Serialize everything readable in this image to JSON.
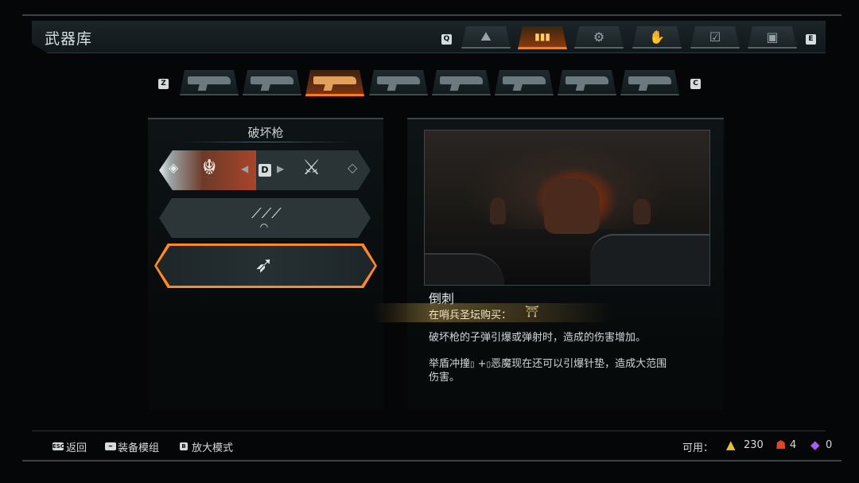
{
  "header": {
    "title": "武器库",
    "prev_key": "Q",
    "next_key": "E",
    "tabs": [
      {
        "icon": "map-icon",
        "glyph": "⛰"
      },
      {
        "icon": "ammo-icon",
        "glyph": "▮▮▮"
      },
      {
        "icon": "gear-icon",
        "glyph": "⚙"
      },
      {
        "icon": "codex-icon",
        "glyph": "✋"
      },
      {
        "icon": "checklist-icon",
        "glyph": "☑"
      },
      {
        "icon": "dossier-icon",
        "glyph": "▣"
      }
    ],
    "active_tab": 1
  },
  "weapons": {
    "prev_key": "Z",
    "next_key": "C",
    "active_index": 2
  },
  "left_panel": {
    "title": "破坏枪",
    "mod1": {
      "left_glyph": "◈",
      "switch_key": "D",
      "right_glyph": "◇",
      "left_icon": "demon-figure-icon",
      "right_icon": "impaled-figure-icon"
    },
    "mod2_glyph": "⟋⟋⟋",
    "mod3_glyph": "➶"
  },
  "detail": {
    "mod_name": "倒刺",
    "buy_text": "在哨兵圣坛购买：",
    "buy_icon_glyph": "⛩",
    "description_1": "破坏枪的子弹引爆或弹射时，造成的伤害增加。",
    "description_2a": "举盾冲撞",
    "description_2b": "+",
    "description_2c": "恶魔现在还可以引爆针垫，造成大范围",
    "description_3": "伤害。"
  },
  "footer": {
    "back_key": "ESC",
    "back_label": "返回",
    "equip_key": "━",
    "equip_label": "装备模组",
    "zoom_key": "B",
    "zoom_label": "放大模式",
    "available_label": "可用：",
    "currency": [
      {
        "name": "sentinel-key",
        "icon": "sentinel-icon",
        "glyph": "▲",
        "value": "230",
        "color": "#e5c13a"
      },
      {
        "name": "demon-core",
        "icon": "demon-core-icon",
        "glyph": "☗",
        "value": "4",
        "color": "#e0442a"
      },
      {
        "name": "crystal",
        "icon": "crystal-icon",
        "glyph": "◆",
        "value": "0",
        "color": "#a85cf0"
      }
    ]
  }
}
